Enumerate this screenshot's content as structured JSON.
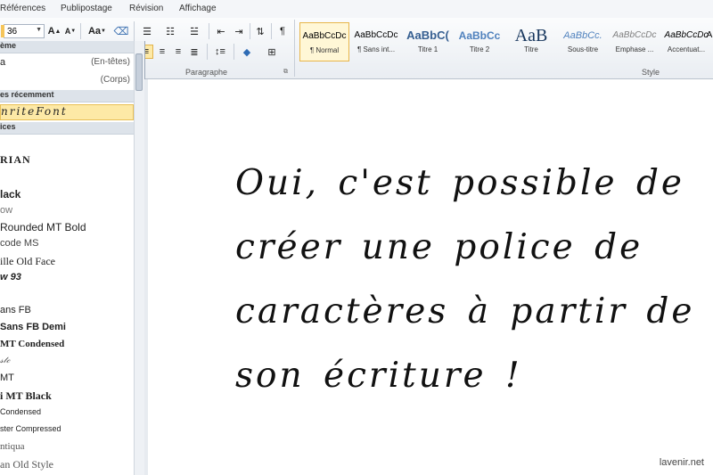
{
  "tabs": [
    "Références",
    "Publipostage",
    "Révision",
    "Affichage"
  ],
  "ribbon": {
    "font_size": "36",
    "grow_font_label": "A",
    "shrink_font_label": "A",
    "change_case_label": "Aa",
    "paragraph_group_label": "Paragraphe",
    "style_group_label": "Style",
    "styles": [
      {
        "preview": "AaBbCcDc",
        "name": "¶ Normal",
        "selected": true,
        "color": "#222222"
      },
      {
        "preview": "AaBbCcDc",
        "name": "¶ Sans int...",
        "selected": false,
        "color": "#222222"
      },
      {
        "preview": "AaBbC(",
        "name": "Titre 1",
        "selected": false,
        "color": "#365f91"
      },
      {
        "preview": "AaBbCc",
        "name": "Titre 2",
        "selected": false,
        "color": "#4f81bd"
      },
      {
        "preview": "AaB",
        "name": "Titre",
        "selected": false,
        "color": "#17365d"
      },
      {
        "preview": "AaBbCc.",
        "name": "Sous-titre",
        "selected": false,
        "color": "#4f81bd"
      },
      {
        "preview": "AaBbCcDc",
        "name": "Emphase ...",
        "selected": false,
        "color": "#666666"
      },
      {
        "preview": "AaBbCcDc",
        "name": "Accentuat...",
        "selected": false,
        "color": "#222222"
      },
      {
        "preview": "A",
        "name": "",
        "selected": false,
        "color": "#222222"
      }
    ]
  },
  "font_dropdown": {
    "theme_header": "ème",
    "theme_fonts": [
      {
        "name": "a",
        "role": "(En-têtes)"
      },
      {
        "name": "",
        "role": "(Corps)"
      }
    ],
    "recent_header": "es récemment",
    "recent_font": "nriteFont",
    "all_header": "ices",
    "fonts": [
      "RIAN",
      "lack",
      "ow",
      "Rounded MT Bold",
      "code MS",
      "ille Old Face",
      "w 93",
      "",
      "ans FB",
      "Sans FB Demi",
      "MT Condensed",
      "𝓈𝓉𝒸",
      "MT",
      "i MT Black",
      "Condensed",
      "ster Compressed",
      "ntiqua",
      "an Old Style"
    ]
  },
  "document": {
    "lines": [
      "Oui, c'est possible de",
      "créer une police de",
      "caractères à partir de",
      "son écriture !"
    ]
  },
  "watermark": "lavenir.net"
}
